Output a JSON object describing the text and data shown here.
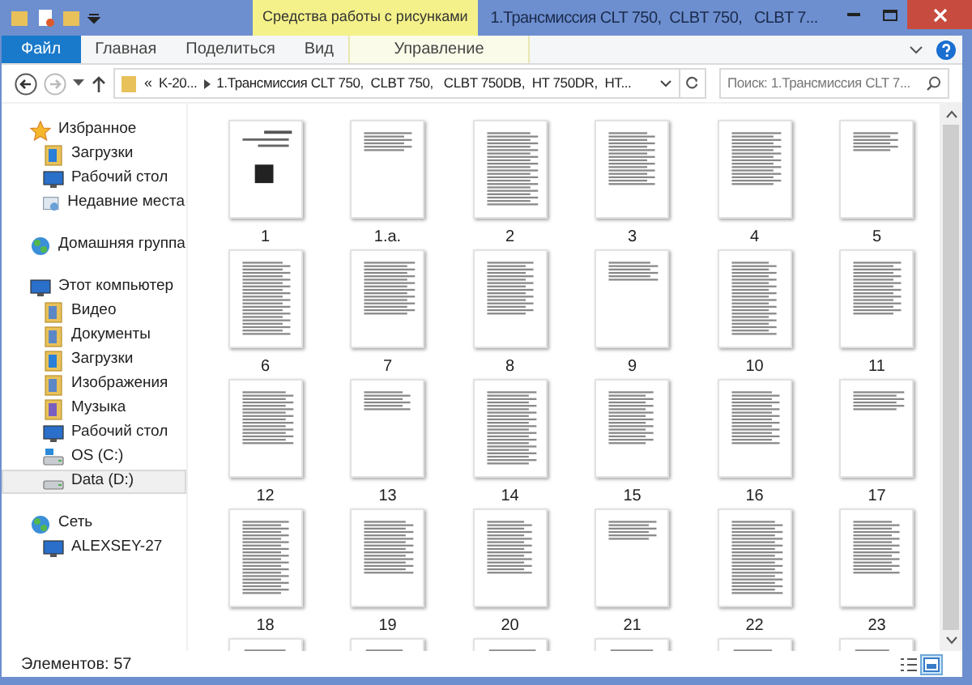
{
  "title_bar": {
    "context_group": "Средства работы с рисунками",
    "title": "1.Трансмиссия CLT 750,  CLBT 750,   CLBT 7..."
  },
  "ribbon_tabs": [
    {
      "label": "Файл",
      "kind": "file",
      "selected": false
    },
    {
      "label": "Главная",
      "kind": "tab",
      "selected": false
    },
    {
      "label": "Поделиться",
      "kind": "tab",
      "selected": false
    },
    {
      "label": "Вид",
      "kind": "tab",
      "selected": false
    },
    {
      "label": "Управление",
      "kind": "context",
      "selected": false
    }
  ],
  "address_bar": {
    "overflow": "«",
    "crumbs": [
      "K-20...",
      "1.Трансмиссия CLT 750,  CLBT 750,   CLBT 750DB,  HT 750DR,  HT..."
    ]
  },
  "search": {
    "placeholder": "Поиск: 1.Трансмиссия CLT 7..."
  },
  "sidebar": [
    {
      "label": "Избранное",
      "kind": "favorites",
      "selected": false,
      "children": [
        {
          "label": "Загрузки",
          "kind": "downloads",
          "selected": false
        },
        {
          "label": "Рабочий стол",
          "kind": "desktop",
          "selected": false
        },
        {
          "label": "Недавние места",
          "kind": "recent",
          "selected": false
        }
      ]
    },
    {
      "label": "Домашняя группа",
      "kind": "homegroup",
      "selected": false
    },
    {
      "label": "Этот компьютер",
      "kind": "computer",
      "selected": false,
      "children": [
        {
          "label": "Видео",
          "kind": "video",
          "selected": false
        },
        {
          "label": "Документы",
          "kind": "documents",
          "selected": false
        },
        {
          "label": "Загрузки",
          "kind": "downloads",
          "selected": false
        },
        {
          "label": "Изображения",
          "kind": "pictures",
          "selected": false
        },
        {
          "label": "Музыка",
          "kind": "music",
          "selected": false
        },
        {
          "label": "Рабочий стол",
          "kind": "desktop",
          "selected": false
        },
        {
          "label": "OS (C:)",
          "kind": "system_drive",
          "selected": false
        },
        {
          "label": "Data (D:)",
          "kind": "drive",
          "selected": true
        }
      ]
    },
    {
      "label": "Сеть",
      "kind": "network",
      "selected": false,
      "children": [
        {
          "label": "ALEXSEY-27",
          "kind": "pc",
          "selected": false
        }
      ]
    }
  ],
  "files": [
    "1",
    "1.a.",
    "2",
    "3",
    "4",
    "5",
    "6",
    "7",
    "8",
    "9",
    "10",
    "11",
    "12",
    "13",
    "14",
    "15",
    "16",
    "17",
    "18",
    "19",
    "20",
    "21",
    "22",
    "23"
  ],
  "status_bar": {
    "count": "Элементов: 57",
    "views": [
      {
        "kind": "details",
        "selected": false
      },
      {
        "kind": "large_icons",
        "selected": true
      }
    ]
  }
}
